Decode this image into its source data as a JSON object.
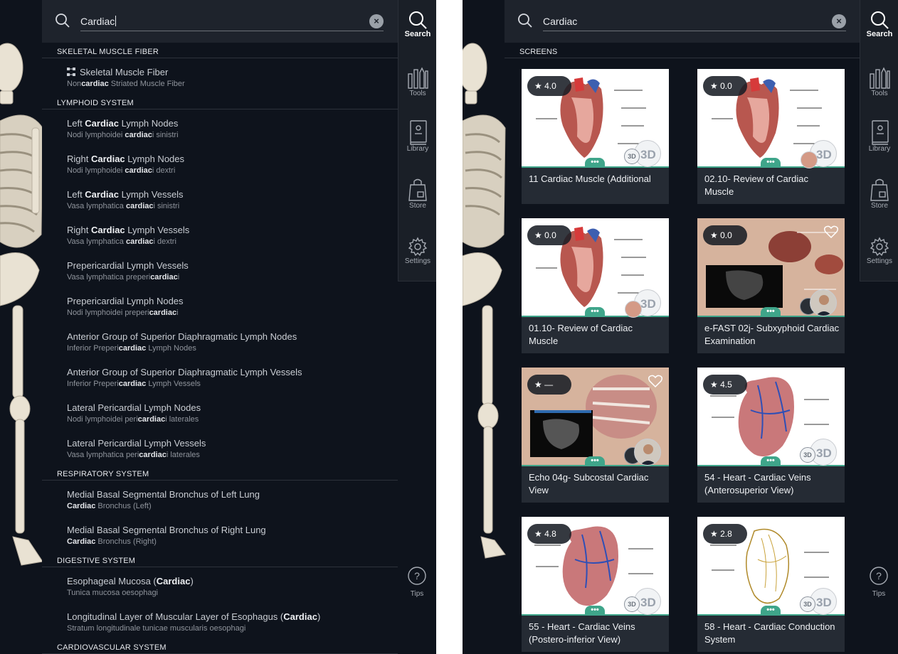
{
  "search": {
    "query": "Cardiac",
    "clear_label": "×"
  },
  "rail": {
    "search": "Search",
    "tools": "Tools",
    "library": "Library",
    "store": "Store",
    "settings": "Settings",
    "tips": "Tips"
  },
  "left_results": [
    {
      "category": "SKELETAL MUSCLE FIBER",
      "items": [
        {
          "title": [
            [
              "Skeletal Muscle Fiber",
              false
            ]
          ],
          "sub": [
            [
              "Non",
              false
            ],
            [
              "cardiac",
              true
            ],
            [
              " Striated Muscle Fiber",
              false
            ]
          ],
          "icon": "fiber-icon"
        }
      ]
    },
    {
      "category": "LYMPHOID SYSTEM",
      "items": [
        {
          "title": [
            [
              "Left ",
              false
            ],
            [
              "Cardiac",
              true
            ],
            [
              " Lymph Nodes",
              false
            ]
          ],
          "sub": [
            [
              "Nodi lymphoidei ",
              false
            ],
            [
              "cardiac",
              true
            ],
            [
              "i sinistri",
              false
            ]
          ]
        },
        {
          "title": [
            [
              "Right ",
              false
            ],
            [
              "Cardiac",
              true
            ],
            [
              " Lymph Nodes",
              false
            ]
          ],
          "sub": [
            [
              "Nodi lymphoidei ",
              false
            ],
            [
              "cardiac",
              true
            ],
            [
              "i dextri",
              false
            ]
          ]
        },
        {
          "title": [
            [
              "Left ",
              false
            ],
            [
              "Cardiac",
              true
            ],
            [
              " Lymph Vessels",
              false
            ]
          ],
          "sub": [
            [
              "Vasa lymphatica ",
              false
            ],
            [
              "cardiac",
              true
            ],
            [
              "i sinistri",
              false
            ]
          ]
        },
        {
          "title": [
            [
              "Right ",
              false
            ],
            [
              "Cardiac",
              true
            ],
            [
              " Lymph Vessels",
              false
            ]
          ],
          "sub": [
            [
              "Vasa lymphatica ",
              false
            ],
            [
              "cardiac",
              true
            ],
            [
              "i dextri",
              false
            ]
          ]
        },
        {
          "title": [
            [
              "Prepericardial Lymph Vessels",
              false
            ]
          ],
          "sub": [
            [
              "Vasa lymphatica preperi",
              false
            ],
            [
              "cardiac",
              true
            ],
            [
              "i",
              false
            ]
          ]
        },
        {
          "title": [
            [
              "Prepericardial Lymph Nodes",
              false
            ]
          ],
          "sub": [
            [
              "Nodi lymphoidei preperi",
              false
            ],
            [
              "cardiac",
              true
            ],
            [
              "i",
              false
            ]
          ]
        },
        {
          "title": [
            [
              "Anterior Group of Superior Diaphragmatic Lymph Nodes",
              false
            ]
          ],
          "sub": [
            [
              "Inferior Preperi",
              false
            ],
            [
              "cardiac",
              true
            ],
            [
              " Lymph Nodes",
              false
            ]
          ]
        },
        {
          "title": [
            [
              "Anterior Group of Superior Diaphragmatic Lymph Vessels",
              false
            ]
          ],
          "sub": [
            [
              "Inferior Preperi",
              false
            ],
            [
              "cardiac",
              true
            ],
            [
              " Lymph Vessels",
              false
            ]
          ]
        },
        {
          "title": [
            [
              "Lateral Pericardial Lymph Nodes",
              false
            ]
          ],
          "sub": [
            [
              "Nodi lymphoidei peri",
              false
            ],
            [
              "cardiac",
              true
            ],
            [
              "i laterales",
              false
            ]
          ]
        },
        {
          "title": [
            [
              "Lateral Pericardial Lymph Vessels",
              false
            ]
          ],
          "sub": [
            [
              "Vasa lymphatica peri",
              false
            ],
            [
              "cardiac",
              true
            ],
            [
              "i laterales",
              false
            ]
          ]
        }
      ]
    },
    {
      "category": "RESPIRATORY SYSTEM",
      "items": [
        {
          "title": [
            [
              "Medial Basal Segmental Bronchus of Left Lung",
              false
            ]
          ],
          "sub": [
            [
              "Cardiac",
              true
            ],
            [
              " Bronchus (Left)",
              false
            ]
          ]
        },
        {
          "title": [
            [
              "Medial Basal Segmental Bronchus of Right Lung",
              false
            ]
          ],
          "sub": [
            [
              "Cardiac",
              true
            ],
            [
              " Bronchus (Right)",
              false
            ]
          ]
        }
      ]
    },
    {
      "category": "DIGESTIVE SYSTEM",
      "items": [
        {
          "title": [
            [
              "Esophageal Mucosa (",
              false
            ],
            [
              "Cardiac",
              true
            ],
            [
              ")",
              false
            ]
          ],
          "sub": [
            [
              "Tunica mucosa oesophagi",
              false
            ]
          ]
        },
        {
          "title": [
            [
              "Longitudinal Layer of Muscular Layer of Esophagus (",
              false
            ],
            [
              "Cardiac",
              true
            ],
            [
              ")",
              false
            ]
          ],
          "sub": [
            [
              "Stratum longitudinale tunicae muscularis oesophagi",
              false
            ]
          ]
        }
      ]
    },
    {
      "category": "CARDIOVASCULAR SYSTEM",
      "items": []
    }
  ],
  "screens_header": "SCREENS",
  "cards": [
    {
      "rating": "4.0",
      "title": "11 Cardiac Muscle (Additional",
      "thumb": "heart-section"
    },
    {
      "rating": "0.0",
      "title": "02.10- Review of Cardiac Muscle",
      "thumb": "heart-section"
    },
    {
      "rating": "0.0",
      "title": "01.10- Review of Cardiac Muscle",
      "thumb": "heart-section"
    },
    {
      "rating": "0.0",
      "title": "e-FAST 02j- Subxyphoid Cardiac Examination",
      "thumb": "ultrasound-torso"
    },
    {
      "rating": "—",
      "title": "Echo 04g- Subcostal Cardiac View",
      "thumb": "ultrasound-chest"
    },
    {
      "rating": "4.5",
      "title": "54 - Heart - Cardiac Veins (Anterosuperior View)",
      "thumb": "heart-full"
    },
    {
      "rating": "4.8",
      "title": "55 - Heart - Cardiac Veins (Postero-inferior View)",
      "thumb": "heart-full"
    },
    {
      "rating": "2.8",
      "title": "58 - Heart - Cardiac Conduction System",
      "thumb": "conduction"
    }
  ],
  "colors": {
    "panel_bg": "#0e131c",
    "accent_teal": "#3fa58a",
    "card_bg": "#252b34"
  }
}
